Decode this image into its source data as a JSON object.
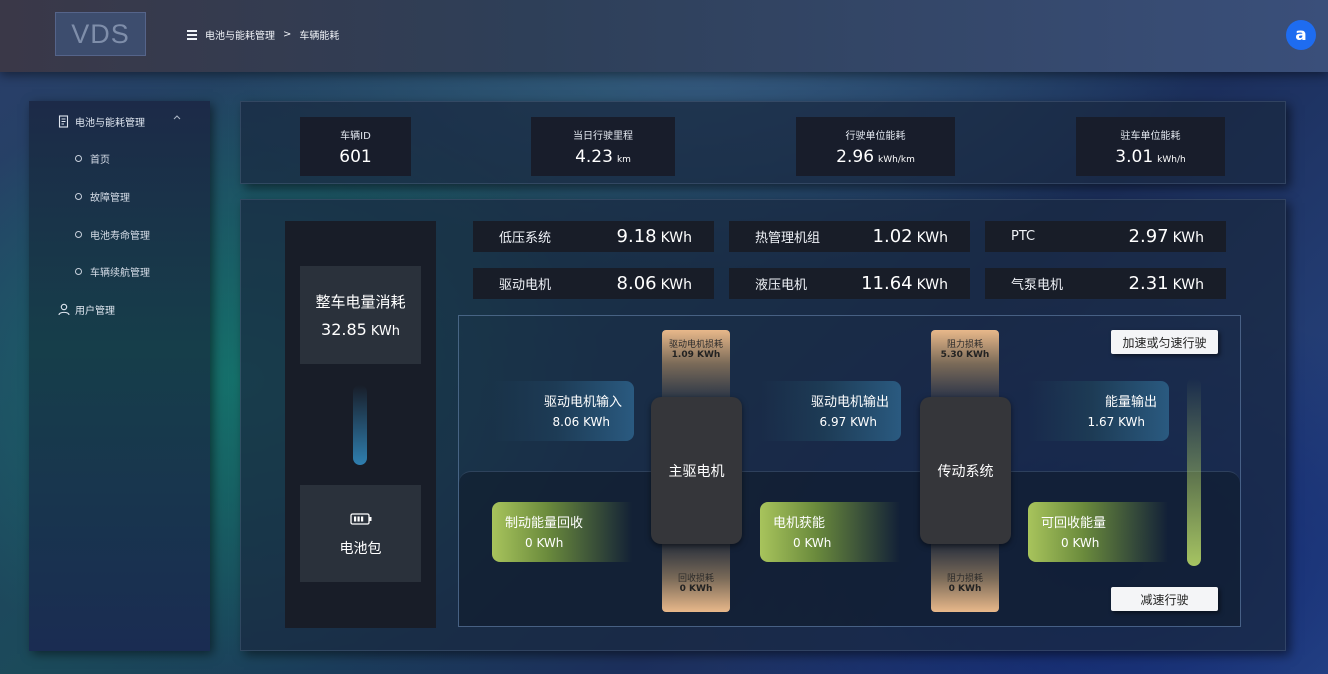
{
  "app": {
    "logo_text": "VDS",
    "user_initial": "a"
  },
  "breadcrumb": {
    "section": "电池与能耗管理",
    "separator": ">",
    "current": "车辆能耗"
  },
  "sidebar": {
    "group_label": "电池与能耗管理",
    "sub_items": [
      "首页",
      "故障管理",
      "电池寿命管理",
      "车辆续航管理"
    ],
    "user_label": "用户管理"
  },
  "stats": [
    {
      "label": "车辆ID",
      "value": "601",
      "unit": ""
    },
    {
      "label": "当日行驶里程",
      "value": "4.23",
      "unit": "km"
    },
    {
      "label": "行驶单位能耗",
      "value": "2.96",
      "unit": "kWh/km"
    },
    {
      "label": "驻车单位能耗",
      "value": "3.01",
      "unit": "kWh/h"
    }
  ],
  "total": {
    "label": "整车电量消耗",
    "value": "32.85",
    "unit": "KWh"
  },
  "battery": {
    "label": "电池包"
  },
  "systems": [
    {
      "label": "低压系统",
      "value": "9.18",
      "unit": "KWh"
    },
    {
      "label": "热管理机组",
      "value": "1.02",
      "unit": "KWh"
    },
    {
      "label": "PTC",
      "value": "2.97",
      "unit": "KWh"
    },
    {
      "label": "驱动电机",
      "value": "8.06",
      "unit": "KWh"
    },
    {
      "label": "液压电机",
      "value": "11.64",
      "unit": "KWh"
    },
    {
      "label": "气泵电机",
      "value": "2.31",
      "unit": "KWh"
    }
  ],
  "flow": {
    "motor_input": {
      "label": "驱动电机输入",
      "value": "8.06 KWh"
    },
    "motor_output": {
      "label": "驱动电机输出",
      "value": "6.97 KWh"
    },
    "energy_output": {
      "label": "能量输出",
      "value": "1.67 KWh"
    },
    "brake_recovery": {
      "label": "制动能量回收",
      "value": "0 KWh"
    },
    "motor_gain": {
      "label": "电机获能",
      "value": "0 KWh"
    },
    "recoverable": {
      "label": "可回收能量",
      "value": "0 KWh"
    },
    "motor_loss": {
      "label": "驱动电机损耗",
      "value": "1.09 KWh"
    },
    "resist_loss_top": {
      "label": "阻力损耗",
      "value": "5.30 KWh"
    },
    "recovery_loss": {
      "label": "回收损耗",
      "value": "0 KWh"
    },
    "resist_loss_bottom": {
      "label": "阻力损耗",
      "value": "0 KWh"
    },
    "main_motor": "主驱电机",
    "transmission": "传动系统",
    "accel_button": "加速或匀速行驶",
    "decel_button": "减速行驶",
    "accel_level": 0.5,
    "decel_level": 1.0
  },
  "colors": {
    "accent_blue": "#2a5a80",
    "accent_green": "#a8c45c",
    "loss_orange": "#e8b88a",
    "avatar_blue": "#1e6cf0"
  },
  "icons": [
    "menu-icon",
    "document-icon",
    "chevron-up-icon",
    "circle-icon",
    "user-icon",
    "battery-icon"
  ]
}
